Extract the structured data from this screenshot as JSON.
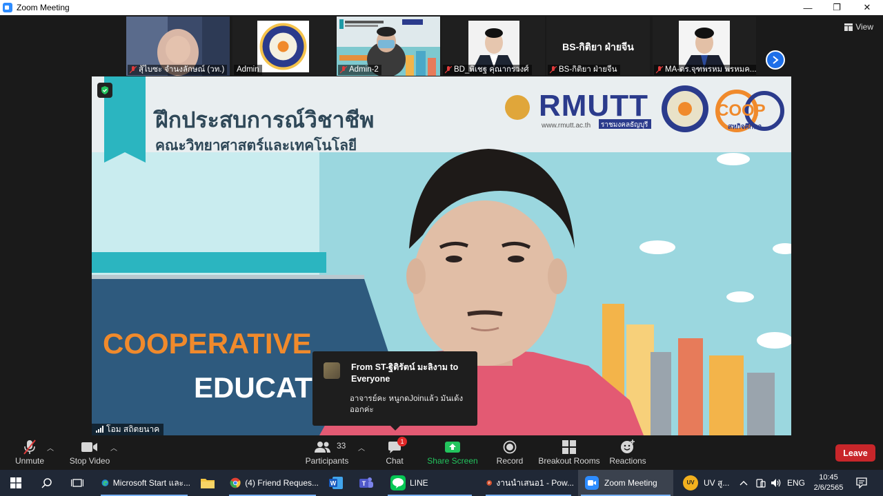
{
  "window": {
    "title": "Zoom Meeting",
    "minimize": "—",
    "restore": "❐",
    "close": "✕"
  },
  "thumbnails": [
    {
      "name": "สุ้ไบซะ จำนงลักษณ์ (วท.)",
      "muted": true
    },
    {
      "name": "Admin",
      "muted": false
    },
    {
      "name": "Admin-2",
      "muted": true
    },
    {
      "name": "BD_พิเชฐ  คุณากรวงศ์",
      "muted": true
    },
    {
      "name": "BS-กิติยา ฝ่ายจีน",
      "muted": true,
      "display": "BS-กิติยา ฝ่ายจีน"
    },
    {
      "name": "MA-ดร.จุฑพรหม พรหมค...",
      "muted": true
    }
  ],
  "view_label": "View",
  "main_video": {
    "speaker": "โอม สถิตยนาค",
    "slide_title": "ฝึกประสบการณ์วิชาชีพ",
    "slide_subtitle": "คณะวิทยาศาสตร์และเทคโนโลยี",
    "slide_text1": "COOPERATIVE",
    "slide_text2": "EDUCAT",
    "logo_text": "RMUTT",
    "logo_url": "www.rmutt.ac.th",
    "logo_sub": "ราชมงคลธัญบุรี",
    "coop_text": "COOP",
    "coop_sub": "สหกิจศึกษา"
  },
  "chat_popup": {
    "from": "From ST-ฐิติรัตน์ มะลิงาม to Everyone",
    "message": "อาจารย์คะ หนูกดJoinแล้ว มันเด้งออกค่ะ"
  },
  "controls": {
    "unmute": "Unmute",
    "stop_video": "Stop Video",
    "participants": "Participants",
    "participants_count": "33",
    "chat": "Chat",
    "chat_badge": "1",
    "share_screen": "Share Screen",
    "record": "Record",
    "breakout_rooms": "Breakout Rooms",
    "reactions": "Reactions",
    "leave": "Leave"
  },
  "taskbar": {
    "items": [
      {
        "label": "Microsoft Start และ..."
      },
      {
        "label": "(4) Friend Reques..."
      },
      {
        "label": "LINE"
      },
      {
        "label": "งานนำเสนอ1 - Pow..."
      },
      {
        "label": "Zoom Meeting"
      }
    ],
    "weather": "UV สู...",
    "lang": "ENG",
    "time": "10:45",
    "date": "2/6/2565"
  },
  "colors": {
    "zoom_blue": "#2d8cff",
    "leave_red": "#c8262a",
    "share_green": "#23c45e",
    "slide_teal": "#2bb5c0",
    "slide_orange": "#f08a2c",
    "shirt_pink": "#e35a73"
  }
}
